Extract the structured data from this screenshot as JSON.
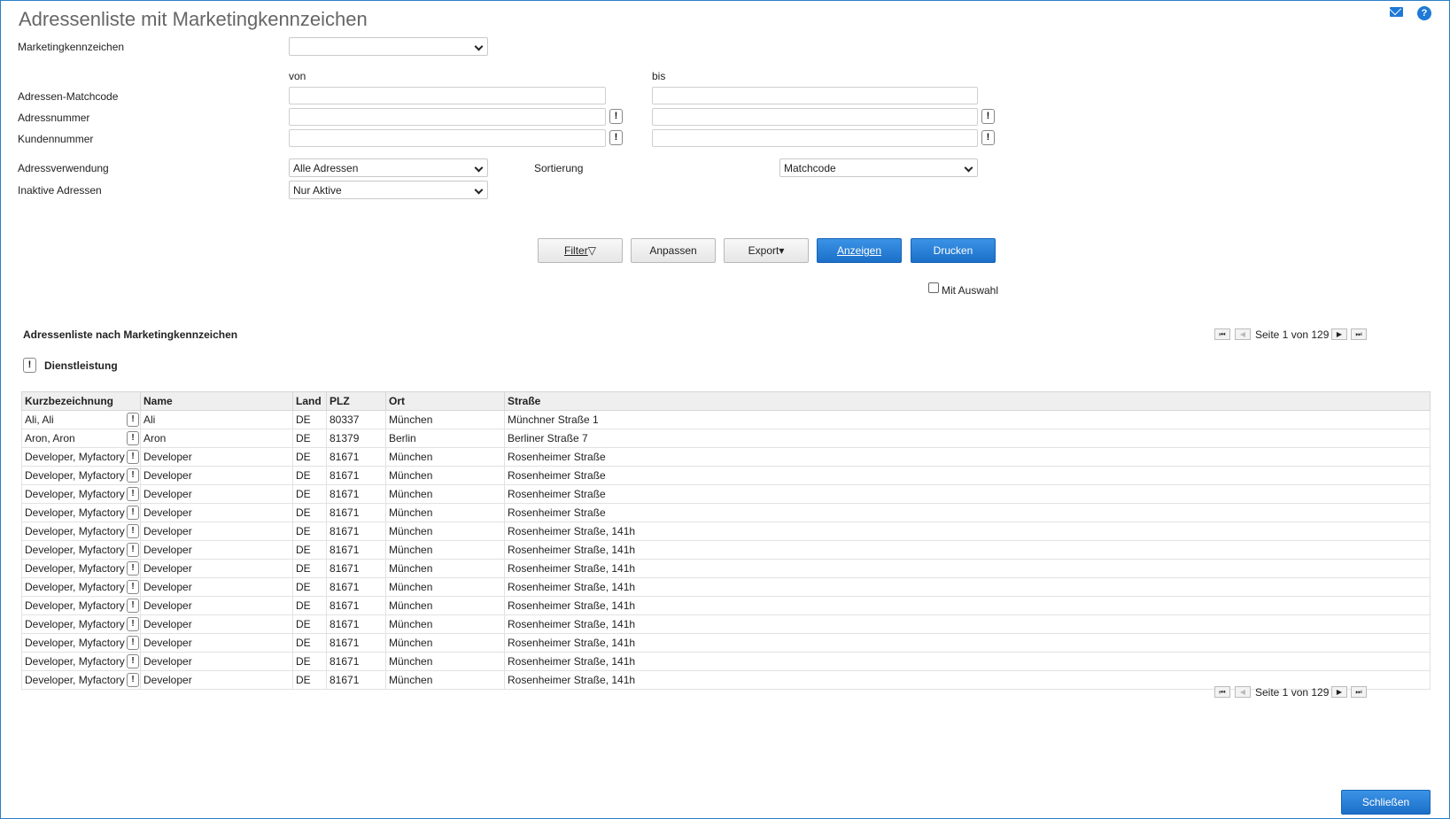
{
  "header": {
    "title": "Adressenliste mit Marketingkennzeichen",
    "mail_icon": "mail-icon",
    "help_icon": "help-icon",
    "help_glyph": "?"
  },
  "form": {
    "marketing_label": "Marketingkennzeichen",
    "marketing_value": "",
    "from_label": "von",
    "to_label": "bis",
    "matchcode_label": "Adressen-Matchcode",
    "adressnummer_label": "Adressnummer",
    "kundennummer_label": "Kundennummer",
    "adressverwendung_label": "Adressverwendung",
    "adressverwendung_value": "Alle Adressen",
    "sortierung_label": "Sortierung",
    "sortierung_value": "Matchcode",
    "inaktive_label": "Inaktive Adressen",
    "inaktive_value": "Nur Aktive",
    "exclamation": "!"
  },
  "toolbar": {
    "filter_label": "Filter",
    "filter_icon": "▽",
    "anpassen_label": "Anpassen",
    "export_label": "Export",
    "export_icon": "▾",
    "anzeigen_label": "Anzeigen",
    "drucken_label": "Drucken",
    "mit_auswahl_label": "Mit Auswahl"
  },
  "result": {
    "section_title": "Adressenliste nach Marketingkennzeichen",
    "group_label": "Dienstleistung",
    "pager_text": "Seite 1 von 129",
    "pager_first": "⏮",
    "pager_prev": "◀",
    "pager_next": "▶",
    "pager_last": "⏭",
    "columns": [
      "Kurzbezeichnung",
      "Name",
      "Land",
      "PLZ",
      "Ort",
      "Straße"
    ],
    "rows": [
      [
        "Ali, Ali",
        "Ali",
        "DE",
        "80337",
        "München",
        "Münchner Straße 1"
      ],
      [
        "Aron, Aron",
        "Aron",
        "DE",
        "81379",
        "Berlin",
        "Berliner Straße 7"
      ],
      [
        "Developer, Myfactory",
        "Developer",
        "DE",
        "81671",
        "München",
        "Rosenheimer Straße"
      ],
      [
        "Developer, Myfactory",
        "Developer",
        "DE",
        "81671",
        "München",
        "Rosenheimer Straße"
      ],
      [
        "Developer, Myfactory",
        "Developer",
        "DE",
        "81671",
        "München",
        "Rosenheimer Straße"
      ],
      [
        "Developer, Myfactory",
        "Developer",
        "DE",
        "81671",
        "München",
        "Rosenheimer Straße"
      ],
      [
        "Developer, Myfactory",
        "Developer",
        "DE",
        "81671",
        "München",
        "Rosenheimer Straße, 141h"
      ],
      [
        "Developer, Myfactory",
        "Developer",
        "DE",
        "81671",
        "München",
        "Rosenheimer Straße, 141h"
      ],
      [
        "Developer, Myfactory",
        "Developer",
        "DE",
        "81671",
        "München",
        "Rosenheimer Straße, 141h"
      ],
      [
        "Developer, Myfactory",
        "Developer",
        "DE",
        "81671",
        "München",
        "Rosenheimer Straße, 141h"
      ],
      [
        "Developer, Myfactory",
        "Developer",
        "DE",
        "81671",
        "München",
        "Rosenheimer Straße, 141h"
      ],
      [
        "Developer, Myfactory",
        "Developer",
        "DE",
        "81671",
        "München",
        "Rosenheimer Straße, 141h"
      ],
      [
        "Developer, Myfactory",
        "Developer",
        "DE",
        "81671",
        "München",
        "Rosenheimer Straße, 141h"
      ],
      [
        "Developer, Myfactory",
        "Developer",
        "DE",
        "81671",
        "München",
        "Rosenheimer Straße, 141h"
      ],
      [
        "Developer, Myfactory",
        "Developer",
        "DE",
        "81671",
        "München",
        "Rosenheimer Straße, 141h"
      ]
    ]
  },
  "footer": {
    "close_label": "Schließen"
  },
  "colors": {
    "accent": "#1b6fc8",
    "border": "#2a7fc7"
  }
}
